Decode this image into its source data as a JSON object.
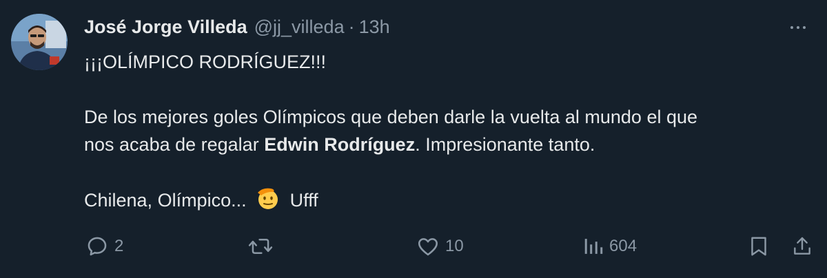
{
  "author": {
    "name": "José Jorge Villeda",
    "handle": "@jj_villeda",
    "separator": "·",
    "time": "13h"
  },
  "tweet": {
    "line1": "¡¡¡OLÍMPICO RODRÍGUEZ!!!",
    "line2": "De los mejores goles Olímpicos que deben darle la vuelta al mundo el que",
    "line3_before": "nos acaba de regalar",
    "line3_bold": "Edwin Rodríguez",
    "line3_after": ". Impresionante tanto.",
    "line4_before": "Chilena, Olímpico...",
    "line4_emoji": "saluting-face-emoji",
    "line4_after": "Ufff"
  },
  "actions": {
    "reply_count": "2",
    "retweet_count": "",
    "like_count": "10",
    "views_count": "604"
  },
  "icons": [
    "more-icon",
    "reply-icon",
    "retweet-icon",
    "like-icon",
    "views-icon",
    "bookmark-icon",
    "share-icon"
  ],
  "colors": {
    "background": "#15202b",
    "text": "#e7e9ea",
    "muted": "#8b98a5"
  }
}
